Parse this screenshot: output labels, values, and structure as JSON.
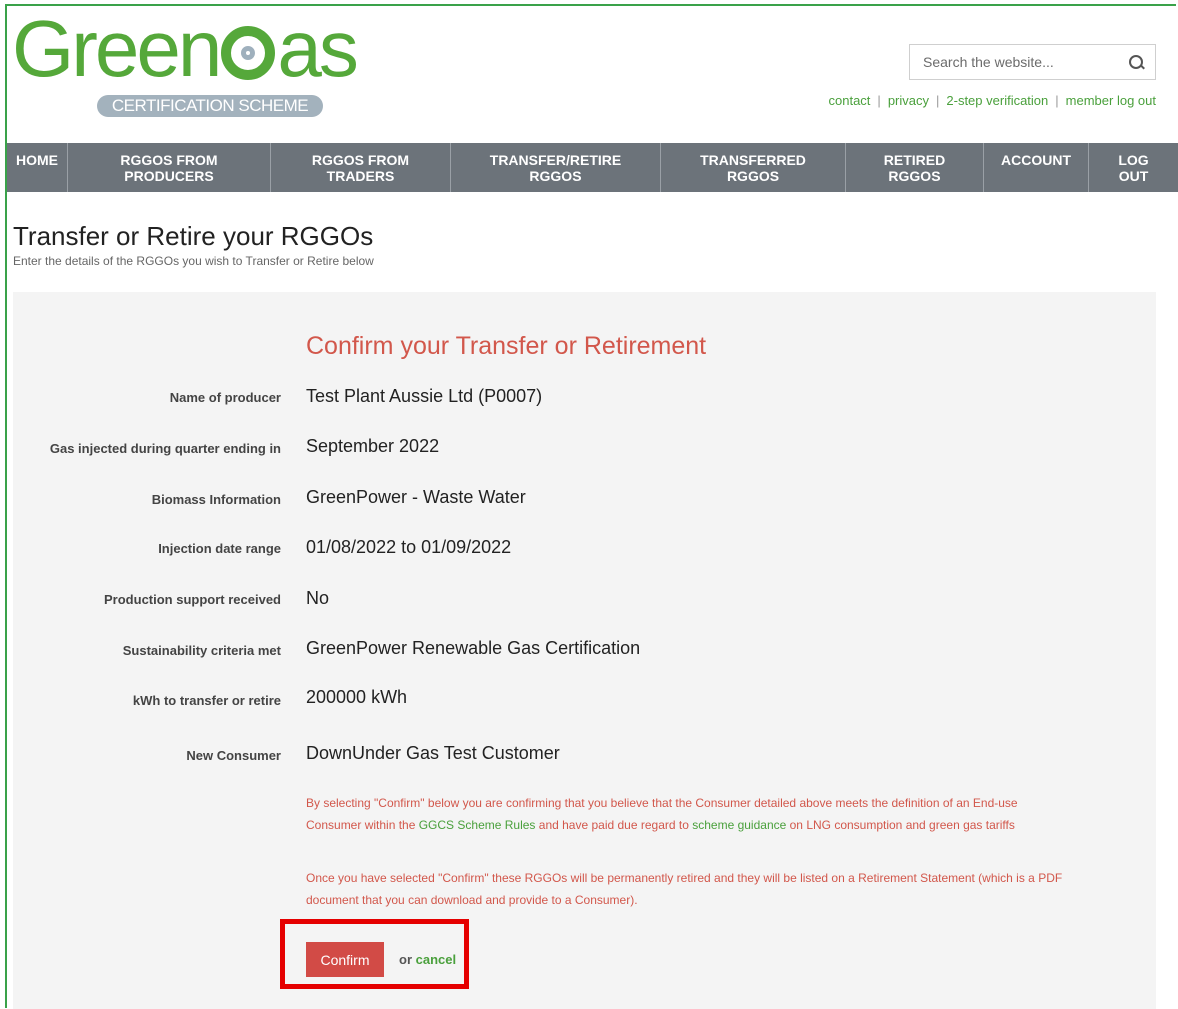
{
  "logo": {
    "word_part1": "Green",
    "word_part2": "as",
    "subtitle": "CERTIFICATION SCHEME"
  },
  "search": {
    "placeholder": "Search the website..."
  },
  "top_links": [
    "contact",
    "privacy",
    "2-step verification",
    "member log out"
  ],
  "nav": [
    {
      "line1": "HOME",
      "line2": ""
    },
    {
      "line1": "RGGOS FROM",
      "line2": "PRODUCERS"
    },
    {
      "line1": "RGGOS FROM",
      "line2": "TRADERS"
    },
    {
      "line1": "TRANSFER/RETIRE",
      "line2": "RGGOS"
    },
    {
      "line1": "TRANSFERRED",
      "line2": "RGGOS"
    },
    {
      "line1": "RETIRED",
      "line2": "RGGOS"
    },
    {
      "line1": "ACCOUNT",
      "line2": ""
    },
    {
      "line1": "LOG",
      "line2": "OUT"
    }
  ],
  "page": {
    "title": "Transfer or Retire your RGGOs",
    "subtitle": "Enter the details of the RGGOs you wish to Transfer or Retire below"
  },
  "confirm": {
    "heading": "Confirm your Transfer or Retirement",
    "rows": [
      {
        "label": "Name of producer",
        "value": "Test Plant Aussie Ltd (P0007)"
      },
      {
        "label": "Gas injected during quarter ending in",
        "value": "September 2022"
      },
      {
        "label": "Biomass Information",
        "value": "GreenPower - Waste Water"
      },
      {
        "label": "Injection date range",
        "value": "01/08/2022 to 01/09/2022"
      },
      {
        "label": "Production support received",
        "value": "No"
      },
      {
        "label": "Sustainability criteria met",
        "value": "GreenPower Renewable Gas Certification"
      },
      {
        "label": "kWh to transfer or retire",
        "value": "200000 kWh"
      },
      {
        "label": "New Consumer",
        "value": "DownUnder Gas Test Customer"
      }
    ],
    "notice1_a": "By selecting \"Confirm\" below you are confirming that you believe that the Consumer detailed above meets the definition of an End-use Consumer within the ",
    "notice1_link1": "GGCS Scheme Rules",
    "notice1_b": " and have paid due regard to ",
    "notice1_link2": "scheme guidance",
    "notice1_c": " on LNG consumption and green gas tariffs",
    "notice2": "Once you have selected \"Confirm\" these RGGOs will be permanently retired and they will be listed on a Retirement Statement (which is a PDF document that you can download and provide to a Consumer).",
    "button_label": "Confirm",
    "or_text": "or ",
    "cancel_label": "cancel"
  },
  "colors": {
    "brand_green": "#55a83a",
    "nav_bg": "#6c737a",
    "alert_red": "#d2574b",
    "button_red": "#d24b46"
  }
}
